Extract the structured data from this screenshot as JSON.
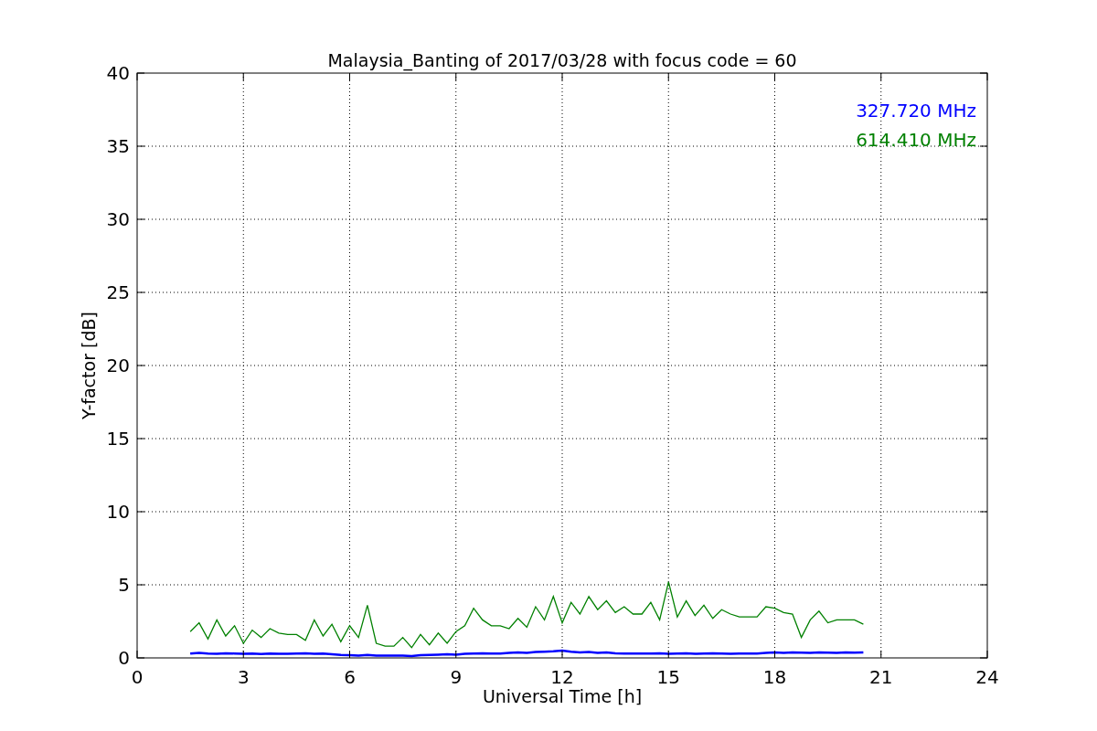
{
  "chart_data": {
    "type": "line",
    "title": "Malaysia_Banting of 2017/03/28 with focus code = 60",
    "xlabel": "Universal Time [h]",
    "ylabel": "Y-factor [dB]",
    "x": [
      1.5,
      1.75,
      2,
      2.25,
      2.5,
      2.75,
      3,
      3.25,
      3.5,
      3.75,
      4,
      4.25,
      4.5,
      4.75,
      5,
      5.25,
      5.5,
      5.75,
      6,
      6.25,
      6.5,
      6.75,
      7,
      7.25,
      7.5,
      7.75,
      8,
      8.25,
      8.5,
      8.75,
      9,
      9.25,
      9.5,
      9.75,
      10,
      10.25,
      10.5,
      10.75,
      11,
      11.25,
      11.5,
      11.75,
      12,
      12.25,
      12.5,
      12.75,
      13,
      13.25,
      13.5,
      13.75,
      14,
      14.25,
      14.5,
      14.75,
      15,
      15.25,
      15.5,
      15.75,
      16,
      16.25,
      16.5,
      16.75,
      17,
      17.25,
      17.5,
      17.75,
      18,
      18.25,
      18.5,
      18.75,
      19,
      19.25,
      19.5,
      19.75,
      20,
      20.25,
      20.5
    ],
    "series": [
      {
        "name": "327.720 MHz",
        "color": "#0000ff",
        "values": [
          0.3,
          0.35,
          0.3,
          0.28,
          0.32,
          0.3,
          0.28,
          0.3,
          0.26,
          0.3,
          0.28,
          0.28,
          0.3,
          0.32,
          0.28,
          0.3,
          0.25,
          0.2,
          0.18,
          0.15,
          0.2,
          0.15,
          0.15,
          0.15,
          0.15,
          0.12,
          0.18,
          0.2,
          0.22,
          0.25,
          0.22,
          0.28,
          0.3,
          0.32,
          0.3,
          0.3,
          0.35,
          0.38,
          0.35,
          0.4,
          0.42,
          0.45,
          0.5,
          0.42,
          0.38,
          0.4,
          0.35,
          0.38,
          0.32,
          0.3,
          0.3,
          0.3,
          0.3,
          0.32,
          0.28,
          0.3,
          0.32,
          0.28,
          0.3,
          0.32,
          0.3,
          0.28,
          0.3,
          0.3,
          0.3,
          0.35,
          0.38,
          0.35,
          0.38,
          0.36,
          0.35,
          0.38,
          0.36,
          0.35,
          0.38,
          0.36,
          0.38
        ]
      },
      {
        "name": "614.410 MHz",
        "color": "#008000",
        "values": [
          1.8,
          2.4,
          1.3,
          2.6,
          1.5,
          2.2,
          1.0,
          1.9,
          1.4,
          2.0,
          1.7,
          1.6,
          1.6,
          1.2,
          2.6,
          1.5,
          2.3,
          1.1,
          2.2,
          1.4,
          3.6,
          1.0,
          0.8,
          0.8,
          1.4,
          0.7,
          1.6,
          0.9,
          1.7,
          1.0,
          1.8,
          2.2,
          3.4,
          2.6,
          2.2,
          2.2,
          2.0,
          2.7,
          2.1,
          3.5,
          2.6,
          4.2,
          2.4,
          3.8,
          3.0,
          4.2,
          3.3,
          3.9,
          3.1,
          3.5,
          3.0,
          3.0,
          3.8,
          2.6,
          5.2,
          2.8,
          3.9,
          2.9,
          3.6,
          2.7,
          3.3,
          3.0,
          2.8,
          2.8,
          2.8,
          3.5,
          3.4,
          3.1,
          3.0,
          1.4,
          2.6,
          3.2,
          2.4,
          2.6,
          2.6,
          2.6,
          2.3
        ]
      }
    ],
    "xlim": [
      0,
      24
    ],
    "ylim": [
      0,
      40
    ],
    "xticks": [
      0,
      3,
      6,
      9,
      12,
      15,
      18,
      21,
      24
    ],
    "yticks": [
      0,
      5,
      10,
      15,
      20,
      25,
      30,
      35,
      40
    ],
    "grid": true
  }
}
